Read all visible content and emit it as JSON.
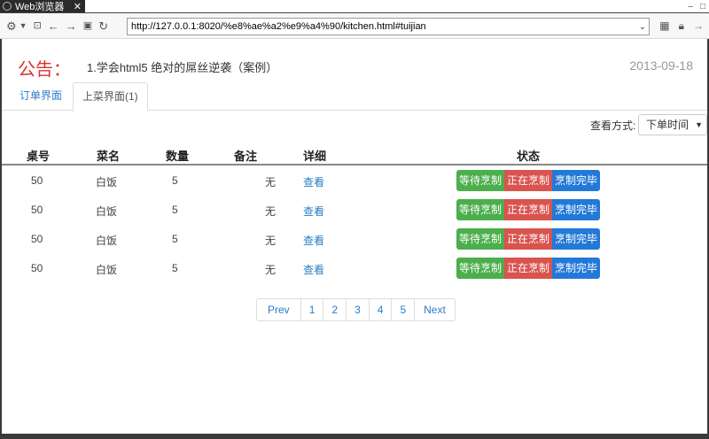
{
  "browser": {
    "tab_title": "Web浏览器",
    "url": "http://127.0.0.1:8020/%e8%ae%a2%e9%a4%90/kitchen.html#tuijian"
  },
  "notice": {
    "label": "公告：",
    "text": "1.学会html5 绝对的屌丝逆袭（案例）",
    "date": "2013-09-18"
  },
  "tabs": [
    {
      "label": "订单界面"
    },
    {
      "label": "上菜界面(1)"
    }
  ],
  "view": {
    "label": "查看方式:",
    "selected": "下单时间"
  },
  "table": {
    "headers": [
      "桌号",
      "菜名",
      "数量",
      "备注",
      "详细",
      "状态"
    ],
    "rows": [
      {
        "table_no": "50",
        "dish": "白饭",
        "qty": "5",
        "note": "无",
        "detail": "查看"
      },
      {
        "table_no": "50",
        "dish": "白饭",
        "qty": "5",
        "note": "无",
        "detail": "查看"
      },
      {
        "table_no": "50",
        "dish": "白饭",
        "qty": "5",
        "note": "无",
        "detail": "查看"
      },
      {
        "table_no": "50",
        "dish": "白饭",
        "qty": "5",
        "note": "无",
        "detail": "查看"
      }
    ],
    "status_buttons": [
      "等待烹制",
      "正在烹制",
      "烹制完毕"
    ]
  },
  "pagination": {
    "prev": "Prev",
    "pages": [
      "1",
      "2",
      "3",
      "4",
      "5"
    ],
    "next": "Next"
  }
}
